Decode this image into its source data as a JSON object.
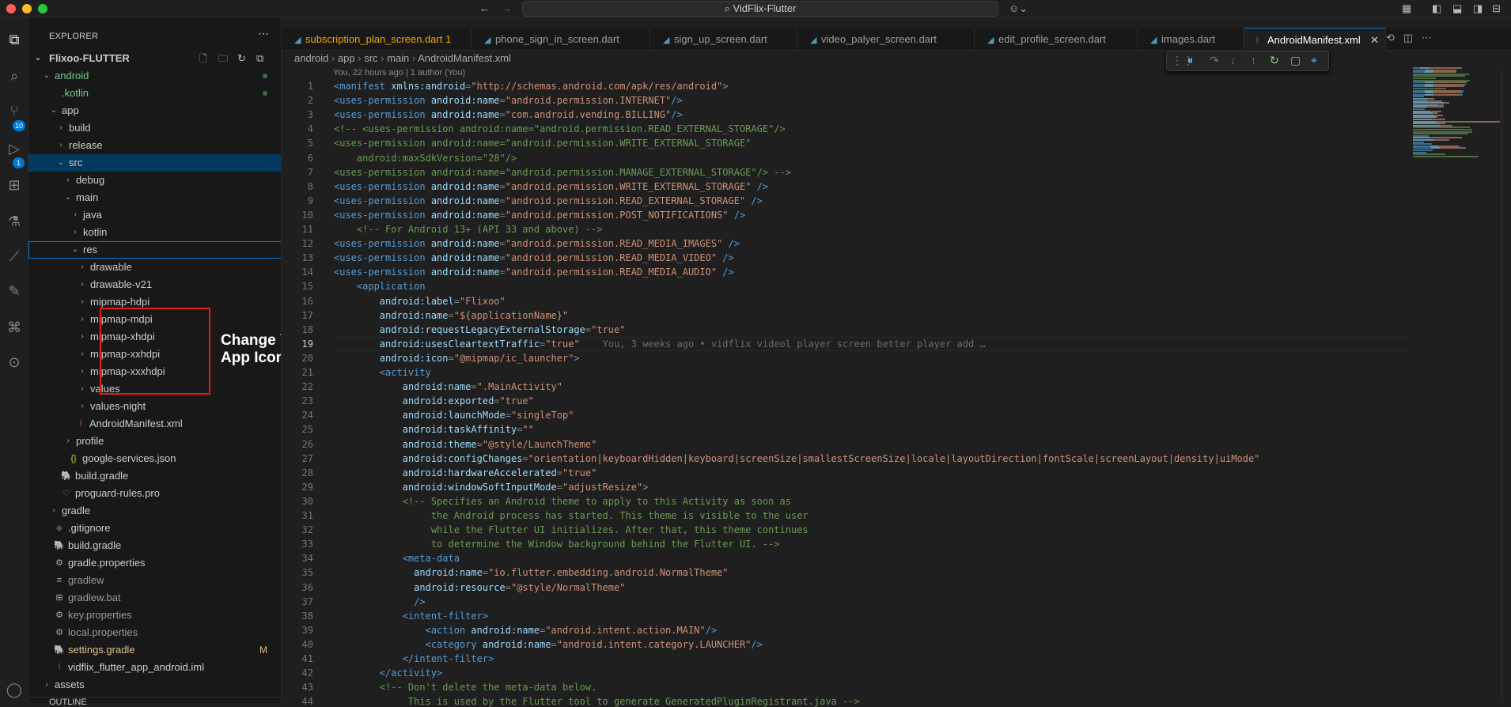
{
  "window": {
    "title": "VidFlix-Flutter",
    "search_icon": "magnifier",
    "copilot_icon": "copilot"
  },
  "colors": {
    "close": "#ff5f57",
    "minimize": "#febc2e",
    "maximize": "#28c840",
    "accent": "#0078d4",
    "annotation_border": "#e51a1a"
  },
  "activity_bar": {
    "source_control_badge": "10",
    "run_badge": "1"
  },
  "sidebar": {
    "title": "EXPLORER",
    "project": "Flixoo-FLUTTER",
    "tree": [
      {
        "label": "android",
        "chev": "⌄",
        "ind": 1,
        "color": "#73c991"
      },
      {
        "label": ".kotlin",
        "chev": "",
        "ind": 2,
        "color": "#73c991"
      },
      {
        "label": "app",
        "chev": "⌄",
        "ind": 2
      },
      {
        "label": "build",
        "chev": "›",
        "ind": 3
      },
      {
        "label": "release",
        "chev": "›",
        "ind": 3
      },
      {
        "label": "src",
        "chev": "⌄",
        "ind": 3,
        "selected": true
      },
      {
        "label": "debug",
        "chev": "›",
        "ind": 4
      },
      {
        "label": "main",
        "chev": "⌄",
        "ind": 4
      },
      {
        "label": "java",
        "chev": "›",
        "ind": 5
      },
      {
        "label": "kotlin",
        "chev": "›",
        "ind": 5
      },
      {
        "label": "res",
        "chev": "⌄",
        "ind": 5,
        "focused": true
      },
      {
        "label": "drawable",
        "chev": "›",
        "ind": 6
      },
      {
        "label": "drawable-v21",
        "chev": "›",
        "ind": 6
      },
      {
        "label": "mipmap-hdpi",
        "chev": "›",
        "ind": 6
      },
      {
        "label": "mipmap-mdpi",
        "chev": "›",
        "ind": 6
      },
      {
        "label": "mipmap-xhdpi",
        "chev": "›",
        "ind": 6
      },
      {
        "label": "mipmap-xxhdpi",
        "chev": "›",
        "ind": 6
      },
      {
        "label": "mipmap-xxxhdpi",
        "chev": "›",
        "ind": 6
      },
      {
        "label": "values",
        "chev": "›",
        "ind": 6
      },
      {
        "label": "values-night",
        "chev": "›",
        "ind": 6
      },
      {
        "label": "AndroidManifest.xml",
        "chev": "",
        "ind": 5,
        "icon": "⦚",
        "icolor": "#e37933"
      },
      {
        "label": "profile",
        "chev": "›",
        "ind": 4
      },
      {
        "label": "google-services.json",
        "chev": "",
        "ind": 4,
        "icon": "{}",
        "icolor": "#cbcb41"
      },
      {
        "label": "build.gradle",
        "chev": "",
        "ind": 3,
        "icon": "🐘",
        "icolor": "#519aba"
      },
      {
        "label": "proguard-rules.pro",
        "chev": "",
        "ind": 3,
        "icon": "♡",
        "icolor": "#e37933"
      },
      {
        "label": "gradle",
        "chev": "›",
        "ind": 2
      },
      {
        "label": ".gitignore",
        "chev": "",
        "ind": 2,
        "icon": "◆",
        "icolor": "#41535b"
      },
      {
        "label": "build.gradle",
        "chev": "",
        "ind": 2,
        "icon": "🐘",
        "icolor": "#519aba"
      },
      {
        "label": "gradle.properties",
        "chev": "",
        "ind": 2,
        "icon": "⚙",
        "icolor": "#aaaaaa"
      },
      {
        "label": "gradlew",
        "chev": "",
        "ind": 2,
        "icon": "≡",
        "icolor": "#aaaaaa",
        "color": "#999999"
      },
      {
        "label": "gradlew.bat",
        "chev": "",
        "ind": 2,
        "icon": "⊞",
        "icolor": "#aaaaaa",
        "color": "#999999"
      },
      {
        "label": "key.properties",
        "chev": "",
        "ind": 2,
        "icon": "⚙",
        "icolor": "#aaaaaa",
        "color": "#999999"
      },
      {
        "label": "local.properties",
        "chev": "",
        "ind": 2,
        "icon": "⚙",
        "icolor": "#aaaaaa",
        "color": "#999999"
      },
      {
        "label": "settings.gradle",
        "chev": "",
        "ind": 2,
        "icon": "🐘",
        "icolor": "#519aba",
        "color": "#e2c08d",
        "mark": "M"
      },
      {
        "label": "vidflix_flutter_app_android.iml",
        "chev": "",
        "ind": 2,
        "icon": "⦚",
        "icolor": "#e37933"
      },
      {
        "label": "assets",
        "chev": "›",
        "ind": 1
      }
    ],
    "annotation": "Change Your App Icon Here",
    "outline": "OUTLINE"
  },
  "tabs": [
    {
      "label": "subscription_plan_screen.dart 1",
      "active": false,
      "error": true
    },
    {
      "label": "phone_sign_in_screen.dart",
      "active": false
    },
    {
      "label": "sign_up_screen.dart",
      "active": false
    },
    {
      "label": "video_palyer_screen.dart",
      "active": false
    },
    {
      "label": "edit_profile_screen.dart",
      "active": false
    },
    {
      "label": "images.dart",
      "active": false
    },
    {
      "label": "AndroidManifest.xml",
      "active": true
    }
  ],
  "breadcrumb": [
    "android",
    "app",
    "src",
    "main",
    "AndroidManifest.xml"
  ],
  "blame_header": "You, 22 hours ago | 1 author (You)",
  "inline_blame": "You, 3 weeks ago • vidflix videol player screen better player add …",
  "current_line": 19,
  "code_lines": [
    [
      [
        "t-tag",
        "<manifest "
      ],
      [
        "t-attr",
        "xmlns:android"
      ],
      [
        "t-p",
        "="
      ],
      [
        "t-str",
        "\"http://schemas.android.com/apk/res/android\""
      ],
      [
        "t-tag",
        ">"
      ]
    ],
    [
      [
        "t-tag",
        "<uses-permission "
      ],
      [
        "t-attr",
        "android:name"
      ],
      [
        "t-p",
        "="
      ],
      [
        "t-str",
        "\"android.permission.INTERNET\""
      ],
      [
        "t-tag",
        "/>"
      ]
    ],
    [
      [
        "t-tag",
        "<uses-permission "
      ],
      [
        "t-attr",
        "android:name"
      ],
      [
        "t-p",
        "="
      ],
      [
        "t-str",
        "\"com.android.vending.BILLING\""
      ],
      [
        "t-tag",
        "/>"
      ]
    ],
    [
      [
        "t-com",
        "<!-- <uses-permission android:name=\"android.permission.READ_EXTERNAL_STORAGE\"/>"
      ]
    ],
    [
      [
        "t-com",
        "<uses-permission android:name=\"android.permission.WRITE_EXTERNAL_STORAGE\""
      ]
    ],
    [
      [
        "t-com",
        "    android:maxSdkVersion=\"28\"/>"
      ]
    ],
    [
      [
        "t-com",
        "<uses-permission android:name=\"android.permission.MANAGE_EXTERNAL_STORAGE\"/> -->"
      ]
    ],
    [
      [
        "t-tag",
        "<uses-permission "
      ],
      [
        "t-attr",
        "android:name"
      ],
      [
        "t-p",
        "="
      ],
      [
        "t-str",
        "\"android.permission.WRITE_EXTERNAL_STORAGE\""
      ],
      [
        "t-tag",
        " />"
      ]
    ],
    [
      [
        "t-tag",
        "<uses-permission "
      ],
      [
        "t-attr",
        "android:name"
      ],
      [
        "t-p",
        "="
      ],
      [
        "t-str",
        "\"android.permission.READ_EXTERNAL_STORAGE\""
      ],
      [
        "t-tag",
        " />"
      ]
    ],
    [
      [
        "t-tag",
        "<uses-permission "
      ],
      [
        "t-attr",
        "android:name"
      ],
      [
        "t-p",
        "="
      ],
      [
        "t-str",
        "\"android.permission.POST_NOTIFICATIONS\""
      ],
      [
        "t-tag",
        " />"
      ]
    ],
    [
      [
        "t-com",
        "    <!-- For Android 13+ (API 33 and above) -->"
      ]
    ],
    [
      [
        "t-tag",
        "<uses-permission "
      ],
      [
        "t-attr",
        "android:name"
      ],
      [
        "t-p",
        "="
      ],
      [
        "t-str",
        "\"android.permission.READ_MEDIA_IMAGES\""
      ],
      [
        "t-tag",
        " />"
      ]
    ],
    [
      [
        "t-tag",
        "<uses-permission "
      ],
      [
        "t-attr",
        "android:name"
      ],
      [
        "t-p",
        "="
      ],
      [
        "t-str",
        "\"android.permission.READ_MEDIA_VIDEO\""
      ],
      [
        "t-tag",
        " />"
      ]
    ],
    [
      [
        "t-tag",
        "<uses-permission "
      ],
      [
        "t-attr",
        "android:name"
      ],
      [
        "t-p",
        "="
      ],
      [
        "t-str",
        "\"android.permission.READ_MEDIA_AUDIO\""
      ],
      [
        "t-tag",
        " />"
      ]
    ],
    [
      [
        "t-tag",
        "    <application"
      ]
    ],
    [
      [
        "t-attr",
        "        android:label"
      ],
      [
        "t-p",
        "="
      ],
      [
        "t-str",
        "\"Flixoo\""
      ]
    ],
    [
      [
        "t-attr",
        "        android:name"
      ],
      [
        "t-p",
        "="
      ],
      [
        "t-str",
        "\"${applicationName}\""
      ]
    ],
    [
      [
        "t-attr",
        "        android:requestLegacyExternalStorage"
      ],
      [
        "t-p",
        "="
      ],
      [
        "t-str",
        "\"true\""
      ]
    ],
    [
      [
        "t-attr",
        "        android:usesCleartextTraffic"
      ],
      [
        "t-p",
        "="
      ],
      [
        "t-str",
        "\"true\""
      ]
    ],
    [
      [
        "t-attr",
        "        android:icon"
      ],
      [
        "t-p",
        "="
      ],
      [
        "t-str",
        "\"@mipmap/ic_launcher\""
      ],
      [
        "t-tag",
        ">"
      ]
    ],
    [
      [
        "t-tag",
        "        <activity"
      ]
    ],
    [
      [
        "t-attr",
        "            android:name"
      ],
      [
        "t-p",
        "="
      ],
      [
        "t-str",
        "\".MainActivity\""
      ]
    ],
    [
      [
        "t-attr",
        "            android:exported"
      ],
      [
        "t-p",
        "="
      ],
      [
        "t-str",
        "\"true\""
      ]
    ],
    [
      [
        "t-attr",
        "            android:launchMode"
      ],
      [
        "t-p",
        "="
      ],
      [
        "t-str",
        "\"singleTop\""
      ]
    ],
    [
      [
        "t-attr",
        "            android:taskAffinity"
      ],
      [
        "t-p",
        "="
      ],
      [
        "t-str",
        "\"\""
      ]
    ],
    [
      [
        "t-attr",
        "            android:theme"
      ],
      [
        "t-p",
        "="
      ],
      [
        "t-str",
        "\"@style/LaunchTheme\""
      ]
    ],
    [
      [
        "t-attr",
        "            android:configChanges"
      ],
      [
        "t-p",
        "="
      ],
      [
        "t-str",
        "\"orientation|keyboardHidden|keyboard|screenSize|smallestScreenSize|locale|layoutDirection|fontScale|screenLayout|density|uiMode\""
      ]
    ],
    [
      [
        "t-attr",
        "            android:hardwareAccelerated"
      ],
      [
        "t-p",
        "="
      ],
      [
        "t-str",
        "\"true\""
      ]
    ],
    [
      [
        "t-attr",
        "            android:windowSoftInputMode"
      ],
      [
        "t-p",
        "="
      ],
      [
        "t-str",
        "\"adjustResize\""
      ],
      [
        "t-tag",
        ">"
      ]
    ],
    [
      [
        "t-com",
        "            <!-- Specifies an Android theme to apply to this Activity as soon as"
      ]
    ],
    [
      [
        "t-com",
        "                 the Android process has started. This theme is visible to the user"
      ]
    ],
    [
      [
        "t-com",
        "                 while the Flutter UI initializes. After that, this theme continues"
      ]
    ],
    [
      [
        "t-com",
        "                 to determine the Window background behind the Flutter UI. -->"
      ]
    ],
    [
      [
        "t-tag",
        "            <meta-data"
      ]
    ],
    [
      [
        "t-attr",
        "              android:name"
      ],
      [
        "t-p",
        "="
      ],
      [
        "t-str",
        "\"io.flutter.embedding.android.NormalTheme\""
      ]
    ],
    [
      [
        "t-attr",
        "              android:resource"
      ],
      [
        "t-p",
        "="
      ],
      [
        "t-str",
        "\"@style/NormalTheme\""
      ]
    ],
    [
      [
        "t-tag",
        "              />"
      ]
    ],
    [
      [
        "t-tag",
        "            <intent-filter>"
      ]
    ],
    [
      [
        "t-tag",
        "                <action "
      ],
      [
        "t-attr",
        "android:name"
      ],
      [
        "t-p",
        "="
      ],
      [
        "t-str",
        "\"android.intent.action.MAIN\""
      ],
      [
        "t-tag",
        "/>"
      ]
    ],
    [
      [
        "t-tag",
        "                <category "
      ],
      [
        "t-attr",
        "android:name"
      ],
      [
        "t-p",
        "="
      ],
      [
        "t-str",
        "\"android.intent.category.LAUNCHER\""
      ],
      [
        "t-tag",
        "/>"
      ]
    ],
    [
      [
        "t-tag",
        "            </intent-filter>"
      ]
    ],
    [
      [
        "t-tag",
        "        </activity>"
      ]
    ],
    [
      [
        "t-com",
        "        <!-- Don't delete the meta-data below."
      ]
    ],
    [
      [
        "t-com",
        "             This is used by the Flutter tool to generate GeneratedPluginRegistrant.java -->"
      ]
    ]
  ]
}
